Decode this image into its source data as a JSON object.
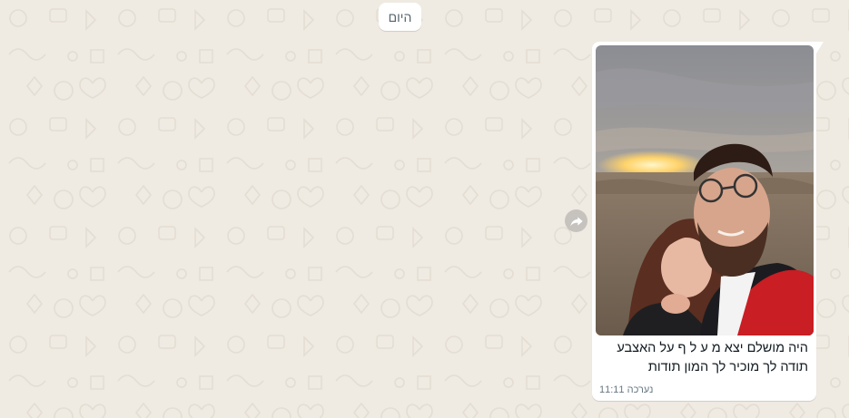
{
  "chat": {
    "date_label": "היום",
    "message": {
      "caption_line1": "היה מושלם יצא מ ע ל ף על האצבע",
      "caption_line2": "תודה לך מוכיר לך המון תודות",
      "edited_label": "נערכה",
      "time": "11:11",
      "photo_alt": "selfie of a smiling couple at sunset in the desert, woman showing engagement ring"
    },
    "forward_icon": "forward-arrow-icon"
  },
  "colors": {
    "wallpaper": "#efeae2",
    "bubble": "#ffffff",
    "meta_text": "#667781",
    "text": "#111b21"
  }
}
